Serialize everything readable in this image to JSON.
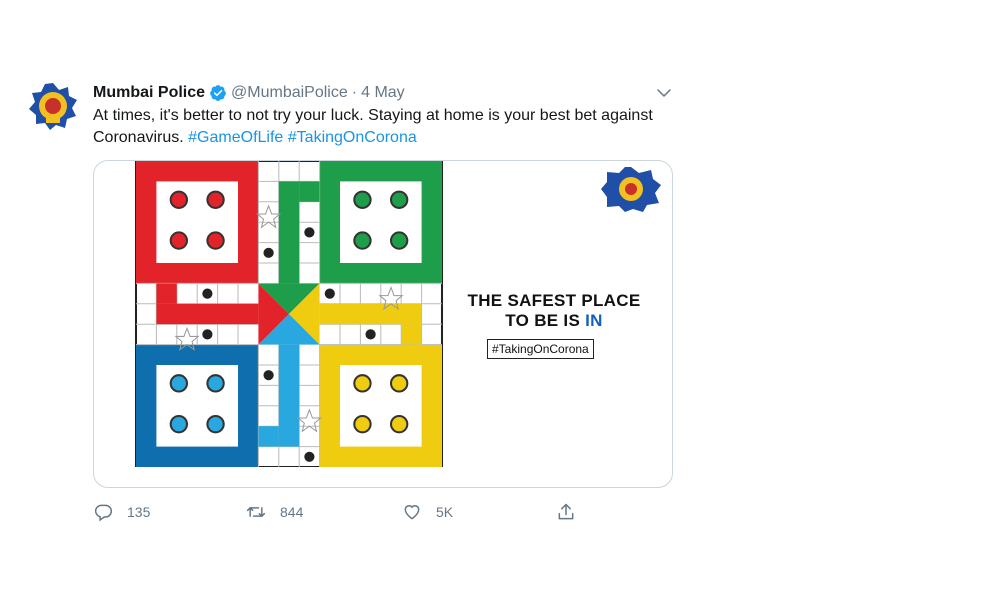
{
  "tweet": {
    "display_name": "Mumbai Police",
    "handle": "@MumbaiPolice",
    "separator": "·",
    "time": "4 May",
    "text": "At times, it's better to not try your luck. Staying at home is your best bet against Coronavirus.",
    "hashtags": [
      "#GameOfLife",
      "#TakingOnCorona"
    ]
  },
  "media": {
    "headline_line1": "THE SAFEST PLACE",
    "headline_line2": "TO BE IS ",
    "headline_emphasis": "IN",
    "tag": "#TakingOnCorona",
    "board_colors": {
      "red": "#e3232a",
      "green": "#1e9e4a",
      "blue": "#0f6fae",
      "yellow": "#f0cc10"
    }
  },
  "actions": {
    "reply_count": "135",
    "retweet_count": "844",
    "like_count": "5K"
  },
  "icons": [
    "avatar-badge",
    "verified-icon",
    "chevron-down-icon",
    "reply-icon",
    "retweet-icon",
    "like-icon",
    "share-icon"
  ]
}
